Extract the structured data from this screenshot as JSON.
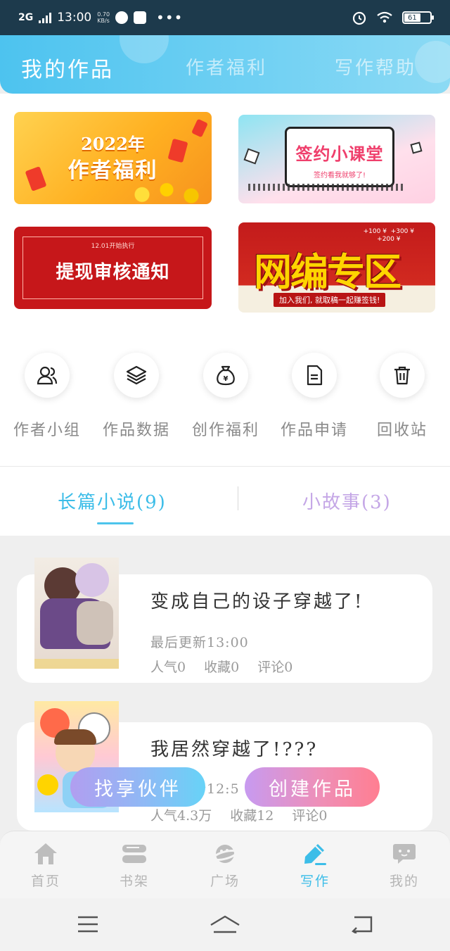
{
  "status_bar": {
    "network": "2G",
    "time": "13:00",
    "speed_value": "0.70",
    "speed_unit": "KB/s",
    "more": "•••",
    "battery": "61"
  },
  "top_tabs": [
    {
      "label": "我的作品",
      "active": true
    },
    {
      "label": "作者福利",
      "active": false
    },
    {
      "label": "写作帮助",
      "active": false
    }
  ],
  "banners": {
    "welfare": {
      "year": "2022年",
      "title": "作者福利"
    },
    "sign_class": {
      "title": "签约小课堂",
      "subtitle": "签约看我就够了!"
    },
    "withdraw": {
      "tag": "12.01开始执行",
      "title": "提现审核通知"
    },
    "web_zone": {
      "prizes": [
        "+100 ¥",
        "+300 ¥",
        "+200 ¥"
      ],
      "title": "网编专区",
      "subtitle": "加入我们, 就取稿一起赚签钱!"
    }
  },
  "quick_actions": [
    {
      "label": "作者小组",
      "icon": "group-icon"
    },
    {
      "label": "作品数据",
      "icon": "layers-icon"
    },
    {
      "label": "创作福利",
      "icon": "money-bag-icon"
    },
    {
      "label": "作品申请",
      "icon": "document-icon"
    },
    {
      "label": "回收站",
      "icon": "trash-icon"
    }
  ],
  "category_tabs": [
    {
      "label": "长篇小说(9)",
      "active": true
    },
    {
      "label": "小故事(3)",
      "active": false
    }
  ],
  "works": [
    {
      "title": "变成自己的设子穿越了!",
      "updated": "最后更新13:00",
      "popularity": "人气0",
      "favorites": "收藏0",
      "comments": "评论0"
    },
    {
      "title": "我居然穿越了!???",
      "updated": "最后更新12:5",
      "popularity": "人气4.3万",
      "favorites": "收藏12",
      "comments": "评论0"
    }
  ],
  "actions": {
    "partner": "找享伙伴",
    "create": "创建作品"
  },
  "bottom_nav": [
    {
      "label": "首页",
      "icon": "home-icon",
      "active": false
    },
    {
      "label": "书架",
      "icon": "bookshelf-icon",
      "active": false
    },
    {
      "label": "广场",
      "icon": "planet-icon",
      "active": false
    },
    {
      "label": "写作",
      "icon": "pen-icon",
      "active": true
    },
    {
      "label": "我的",
      "icon": "chat-bubble-icon",
      "active": false
    }
  ],
  "colors": {
    "accent": "#3cbde8",
    "header": "#4dc3ef",
    "create_button": "#ff7e91",
    "partner_button": "#67d3f7"
  }
}
